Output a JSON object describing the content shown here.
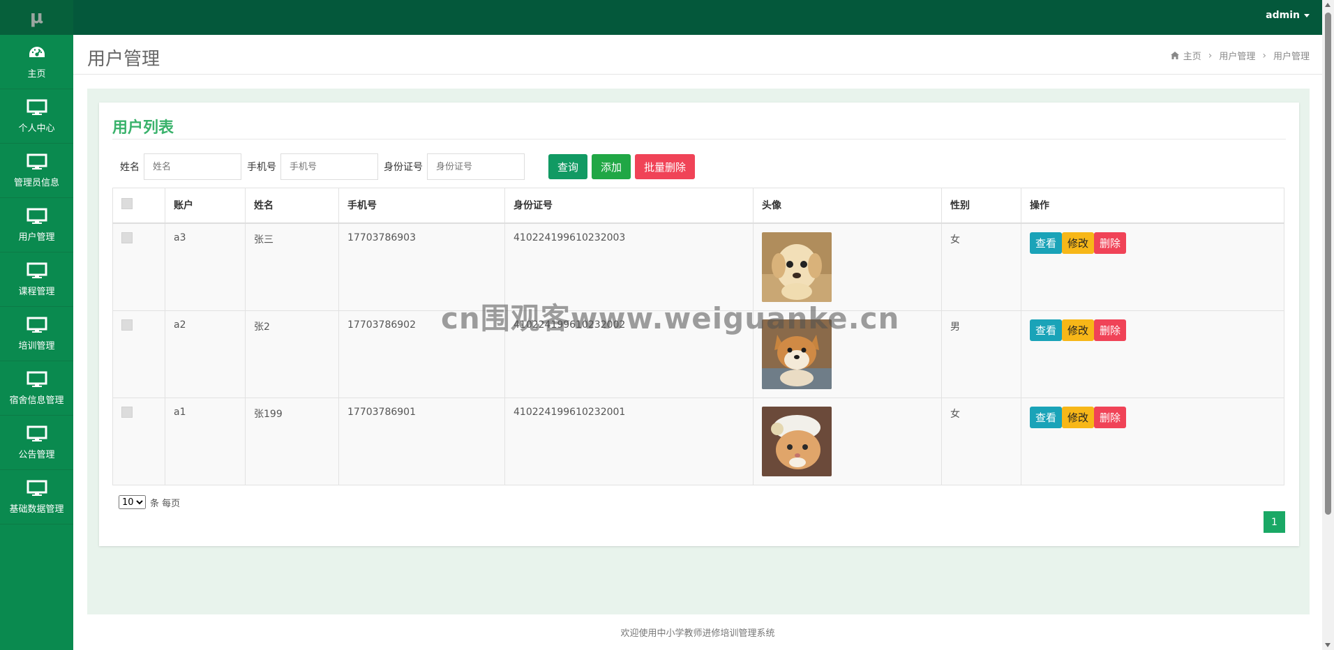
{
  "brand": {
    "logo_text": "μ"
  },
  "sidebar": {
    "items": [
      {
        "label": "主页",
        "icon": "dashboard-icon"
      },
      {
        "label": "个人中心",
        "icon": "monitor-icon"
      },
      {
        "label": "管理员信息",
        "icon": "monitor-icon"
      },
      {
        "label": "用户管理",
        "icon": "monitor-icon"
      },
      {
        "label": "课程管理",
        "icon": "monitor-icon"
      },
      {
        "label": "培训管理",
        "icon": "monitor-icon"
      },
      {
        "label": "宿舍信息管理",
        "icon": "monitor-icon"
      },
      {
        "label": "公告管理",
        "icon": "monitor-icon"
      },
      {
        "label": "基础数据管理",
        "icon": "monitor-icon"
      }
    ]
  },
  "topbar": {
    "user": "admin"
  },
  "header": {
    "title": "用户管理",
    "breadcrumb": [
      "主页",
      "用户管理",
      "用户管理"
    ]
  },
  "card": {
    "title": "用户列表"
  },
  "search": {
    "name_label": "姓名",
    "name_placeholder": "姓名",
    "phone_label": "手机号",
    "phone_placeholder": "手机号",
    "idcard_label": "身份证号",
    "idcard_placeholder": "身份证号",
    "query_label": "查询",
    "add_label": "添加",
    "batch_delete_label": "批量删除"
  },
  "table": {
    "headers": [
      "账户",
      "姓名",
      "手机号",
      "身份证号",
      "头像",
      "性别",
      "操作"
    ],
    "rows": [
      {
        "account": "a3",
        "name": "张三",
        "phone": "17703786903",
        "idcard": "410224199610232003",
        "gender": "女",
        "avatar": "puppy-photo"
      },
      {
        "account": "a2",
        "name": "张2",
        "phone": "17703786902",
        "idcard": "410224199610232002",
        "gender": "男",
        "avatar": "shiba-photo"
      },
      {
        "account": "a1",
        "name": "张199",
        "phone": "17703786901",
        "idcard": "410224199610232001",
        "gender": "女",
        "avatar": "cat-photo"
      }
    ],
    "actions": {
      "view": "查看",
      "edit": "修改",
      "delete": "删除"
    }
  },
  "pager": {
    "page_size": "10",
    "per_page_text": "条 每页",
    "current_page": "1"
  },
  "footer": {
    "text": "欢迎使用中小学教师进修培训管理系统"
  },
  "watermark": "cn围观客www.weiguanke.cn",
  "colors": {
    "sidebar": "#0a8a4f",
    "topbar": "#04583b",
    "accent": "#39b26b",
    "danger": "#f04357",
    "warning": "#f7b718",
    "info": "#1aa3b8"
  }
}
